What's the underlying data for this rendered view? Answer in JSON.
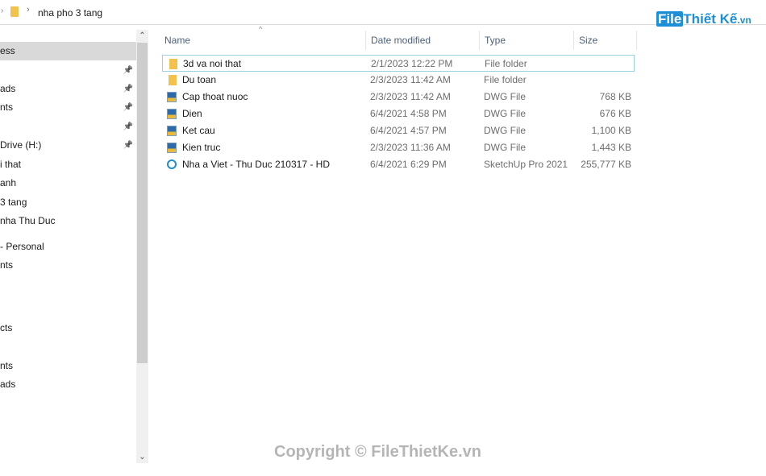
{
  "address": {
    "path": "nha pho 3 tang"
  },
  "sidebar": {
    "items": [
      {
        "label": "ess",
        "selected": true,
        "pinned": false
      },
      {
        "label": "",
        "pinned": true
      },
      {
        "label": "ads",
        "pinned": true
      },
      {
        "label": "nts",
        "pinned": true
      },
      {
        "label": "",
        "pinned": true
      },
      {
        "label": "Drive (H:)",
        "pinned": true
      },
      {
        "label": "i that"
      },
      {
        "label": "anh"
      },
      {
        "label": "3 tang"
      },
      {
        "label": "nha Thu Duc"
      },
      {
        "label": "- Personal"
      },
      {
        "label": "nts"
      },
      {
        "label": ""
      },
      {
        "label": ""
      },
      {
        "label": "cts"
      },
      {
        "label": ""
      },
      {
        "label": "nts"
      },
      {
        "label": "ads"
      }
    ]
  },
  "columns": {
    "name": "Name",
    "date": "Date modified",
    "type": "Type",
    "size": "Size"
  },
  "files": [
    {
      "name": "3d va noi that",
      "date": "2/1/2023 12:22 PM",
      "type": "File folder",
      "size": "",
      "icon": "folder-icon"
    },
    {
      "name": "Du toan",
      "date": "2/3/2023 11:42 AM",
      "type": "File folder",
      "size": "",
      "icon": "folder-icon"
    },
    {
      "name": "Cap thoat nuoc",
      "date": "2/3/2023 11:42 AM",
      "type": "DWG File",
      "size": "768 KB",
      "icon": "dwg-file-icon"
    },
    {
      "name": "Dien",
      "date": "6/4/2021 4:58 PM",
      "type": "DWG File",
      "size": "676 KB",
      "icon": "dwg-file-icon"
    },
    {
      "name": "Ket cau",
      "date": "6/4/2021 4:57 PM",
      "type": "DWG File",
      "size": "1,100 KB",
      "icon": "dwg-file-icon"
    },
    {
      "name": "Kien truc",
      "date": "2/3/2023 11:36 AM",
      "type": "DWG File",
      "size": "1,443 KB",
      "icon": "dwg-file-icon"
    },
    {
      "name": "Nha a Viet - Thu Duc 210317 - HD",
      "date": "6/4/2021 6:29 PM",
      "type": "SketchUp Pro 2021",
      "size": "255,777 KB",
      "icon": "sketchup-file-icon"
    }
  ],
  "watermark": {
    "logo_box": "File",
    "logo_text": "Thiết Kế",
    "logo_suffix": ".vn",
    "copyright": "Copyright © FileThietKe.vn"
  }
}
